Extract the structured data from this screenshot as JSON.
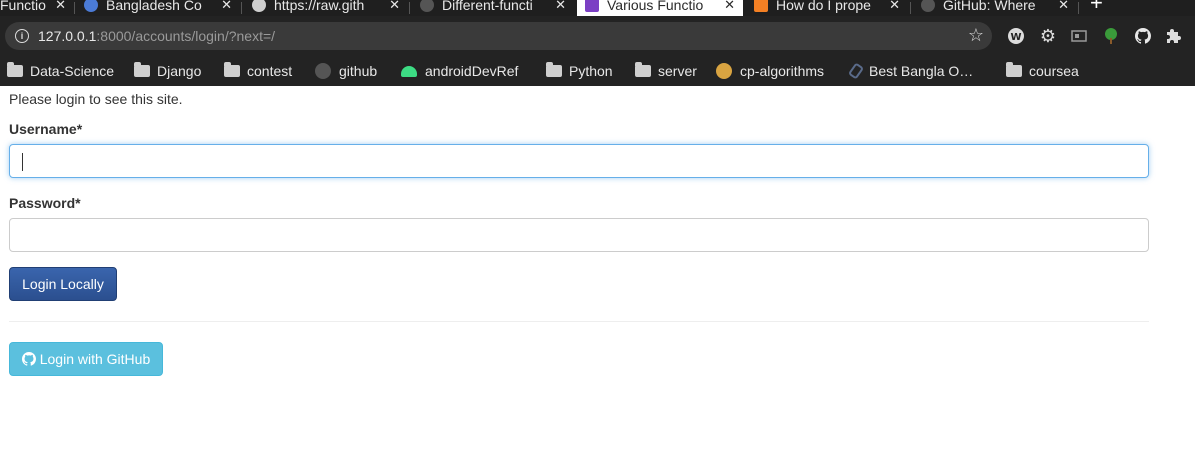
{
  "browser": {
    "tabs": [
      {
        "title": "Functio",
        "active": false
      },
      {
        "title": "Bangladesh Co",
        "active": false
      },
      {
        "title": "https://raw.gith",
        "active": false
      },
      {
        "title": "Different-functi",
        "active": false
      },
      {
        "title": "Various Functio",
        "active": true
      },
      {
        "title": "How do I prope",
        "active": false
      },
      {
        "title": "GitHub: Where",
        "active": false
      }
    ],
    "tab_close": "✕",
    "new_tab": "+",
    "url_host": "127.0.0.1",
    "url_rest": ":8000/accounts/login/?next=/",
    "bookmarks": [
      {
        "label": "Data-Science",
        "icon": "folder-icon"
      },
      {
        "label": "Django",
        "icon": "folder-icon"
      },
      {
        "label": "contest",
        "icon": "folder-icon"
      },
      {
        "label": "github",
        "icon": "github-icon"
      },
      {
        "label": "androidDevRef",
        "icon": "android-icon"
      },
      {
        "label": "Python",
        "icon": "folder-icon"
      },
      {
        "label": "server",
        "icon": "folder-icon"
      },
      {
        "label": "cp-algorithms",
        "icon": "cp-algorithms-icon"
      },
      {
        "label": "Best Bangla O…",
        "icon": "link-icon"
      },
      {
        "label": "coursea",
        "icon": "folder-icon"
      }
    ]
  },
  "login": {
    "intro": "Please login to see this site.",
    "username_label": "Username*",
    "username_value": "",
    "password_label": "Password*",
    "password_value": "",
    "login_button": "Login Locally",
    "github_button": "Login with GitHub"
  },
  "colors": {
    "primary_button": "#2e5598",
    "info_button": "#5bc0de",
    "focus_border": "#66afe9"
  }
}
